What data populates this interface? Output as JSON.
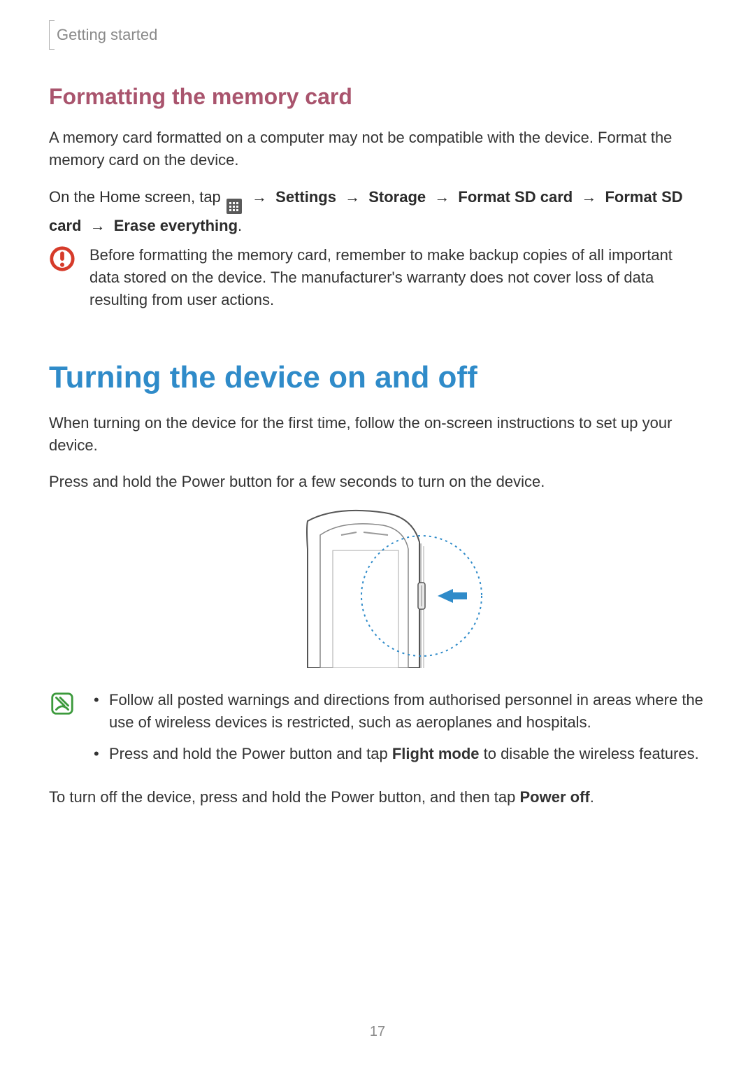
{
  "header": {
    "section": "Getting started"
  },
  "section1": {
    "heading": "Formatting the memory card",
    "para1": "A memory card formatted on a computer may not be compatible with the device. Format the memory card on the device.",
    "path": {
      "prefix": "On the Home screen, tap ",
      "arrow": "→",
      "settings": "Settings",
      "storage": "Storage",
      "format1": "Format SD card",
      "format2": "Format SD card",
      "erase": "Erase everything",
      "period": "."
    },
    "caution": "Before formatting the memory card, remember to make backup copies of all important data stored on the device. The manufacturer's warranty does not cover loss of data resulting from user actions."
  },
  "section2": {
    "heading": "Turning the device on and off",
    "para1": "When turning on the device for the first time, follow the on-screen instructions to set up your device.",
    "para2": "Press and hold the Power button for a few seconds to turn on the device.",
    "tips": {
      "bullet1": "Follow all posted warnings and directions from authorised personnel in areas where the use of wireless devices is restricted, such as aeroplanes and hospitals.",
      "bullet2_a": "Press and hold the Power button and tap ",
      "bullet2_bold": "Flight mode",
      "bullet2_b": " to disable the wireless features."
    },
    "para3_a": "To turn off the device, press and hold the Power button, and then tap ",
    "para3_bold": "Power off",
    "para3_b": "."
  },
  "page_number": "17"
}
